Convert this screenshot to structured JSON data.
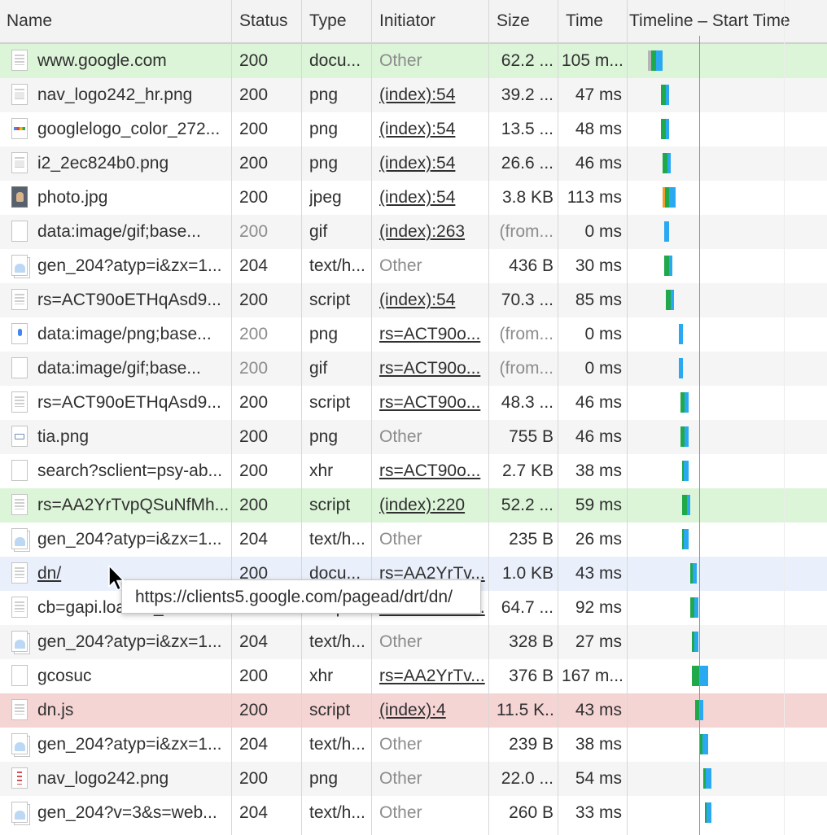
{
  "columns": {
    "name": "Name",
    "status": "Status",
    "type": "Type",
    "initiator": "Initiator",
    "size": "Size",
    "time": "Time",
    "timeline": "Timeline – Start Time"
  },
  "tooltip": "https://clients5.google.com/pagead/drt/dn/",
  "colors": {
    "highlight_green": "#dcf5d8",
    "highlight_red": "#f5d4d4",
    "hover_blue": "#eaf0fb",
    "stripe": "#f5f5f5",
    "wait_green": "#1fa94b",
    "download_blue": "#2aa8f2",
    "start_line_red": "#ee6b6b"
  },
  "requests": [
    {
      "name": "www.google.com",
      "status": "200",
      "type": "docu...",
      "initiator": "Other",
      "size": "62.2 ...",
      "time": "105 m...",
      "icon": "document-icon",
      "highlight": "green"
    },
    {
      "name": "nav_logo242_hr.png",
      "status": "200",
      "type": "png",
      "initiator": "(index):54",
      "size": "39.2 ...",
      "time": "47 ms",
      "icon": "image-file-icon"
    },
    {
      "name": "googlelogo_color_272...",
      "status": "200",
      "type": "png",
      "initiator": "(index):54",
      "size": "13.5 ...",
      "time": "48 ms",
      "icon": "google-logo-icon"
    },
    {
      "name": "i2_2ec824b0.png",
      "status": "200",
      "type": "png",
      "initiator": "(index):54",
      "size": "26.6 ...",
      "time": "46 ms",
      "icon": "image-file-icon"
    },
    {
      "name": "photo.jpg",
      "status": "200",
      "type": "jpeg",
      "initiator": "(index):54",
      "size": "3.8 KB",
      "time": "113 ms",
      "icon": "photo-thumbnail-icon"
    },
    {
      "name": "data:image/gif;base...",
      "status": "200",
      "type": "gif",
      "initiator": "(index):263",
      "size": "(from...",
      "time": "0 ms",
      "icon": "blank-file-icon",
      "status_gray": true,
      "size_gray": true
    },
    {
      "name": "gen_204?atyp=i&zx=1...",
      "status": "204",
      "type": "text/h...",
      "initiator": "Other",
      "size": "436 B",
      "time": "30 ms",
      "icon": "ping-file-icon"
    },
    {
      "name": "rs=ACT90oETHqAsd9...",
      "status": "200",
      "type": "script",
      "initiator": "(index):54",
      "size": "70.3 ...",
      "time": "85 ms",
      "icon": "script-file-icon"
    },
    {
      "name": "data:image/png;base...",
      "status": "200",
      "type": "png",
      "initiator": "rs=ACT90o...",
      "size": "(from...",
      "time": "0 ms",
      "icon": "mic-image-icon",
      "status_gray": true,
      "size_gray": true
    },
    {
      "name": "data:image/gif;base...",
      "status": "200",
      "type": "gif",
      "initiator": "rs=ACT90o...",
      "size": "(from...",
      "time": "0 ms",
      "icon": "blank-file-icon",
      "status_gray": true,
      "size_gray": true
    },
    {
      "name": "rs=ACT90oETHqAsd9...",
      "status": "200",
      "type": "script",
      "initiator": "rs=ACT90o...",
      "size": "48.3 ...",
      "time": "46 ms",
      "icon": "script-file-icon"
    },
    {
      "name": "tia.png",
      "status": "200",
      "type": "png",
      "initiator": "Other",
      "size": "755 B",
      "time": "46 ms",
      "icon": "keyboard-image-icon"
    },
    {
      "name": "search?sclient=psy-ab...",
      "status": "200",
      "type": "xhr",
      "initiator": "rs=ACT90o...",
      "size": "2.7 KB",
      "time": "38 ms",
      "icon": "blank-file-icon"
    },
    {
      "name": "rs=AA2YrTvpQSuNfMh...",
      "status": "200",
      "type": "script",
      "initiator": "(index):220",
      "size": "52.2 ...",
      "time": "59 ms",
      "icon": "script-file-icon",
      "highlight": "green"
    },
    {
      "name": "gen_204?atyp=i&zx=1...",
      "status": "204",
      "type": "text/h...",
      "initiator": "Other",
      "size": "235 B",
      "time": "26 ms",
      "icon": "ping-file-icon"
    },
    {
      "name": "dn/",
      "status": "200",
      "type": "docu...",
      "initiator": "rs=AA2YrTv...",
      "size": "1.0 KB",
      "time": "43 ms",
      "icon": "document-icon",
      "highlight": "hover",
      "name_link": true
    },
    {
      "name": "cb=gapi.loaded_0",
      "status": "200",
      "type": "script",
      "initiator": "rs=AA2YrTv...",
      "size": "64.7 ...",
      "time": "92 ms",
      "icon": "script-file-icon"
    },
    {
      "name": "gen_204?atyp=i&zx=1...",
      "status": "204",
      "type": "text/h...",
      "initiator": "Other",
      "size": "328 B",
      "time": "27 ms",
      "icon": "ping-file-icon"
    },
    {
      "name": "gcosuc",
      "status": "200",
      "type": "xhr",
      "initiator": "rs=AA2YrTv...",
      "size": "376 B",
      "time": "167 m...",
      "icon": "blank-file-icon"
    },
    {
      "name": "dn.js",
      "status": "200",
      "type": "script",
      "initiator": "(index):4",
      "size": "11.5 K...",
      "time": "43 ms",
      "icon": "script-file-icon",
      "highlight": "red"
    },
    {
      "name": "gen_204?atyp=i&zx=1...",
      "status": "204",
      "type": "text/h...",
      "initiator": "Other",
      "size": "239 B",
      "time": "38 ms",
      "icon": "ping-file-icon"
    },
    {
      "name": "nav_logo242.png",
      "status": "200",
      "type": "png",
      "initiator": "Other",
      "size": "22.0 ...",
      "time": "54 ms",
      "icon": "sprite-image-icon"
    },
    {
      "name": "gen_204?v=3&s=web...",
      "status": "204",
      "type": "text/h...",
      "initiator": "Other",
      "size": "260 B",
      "time": "33 ms",
      "icon": "ping-file-icon"
    }
  ]
}
